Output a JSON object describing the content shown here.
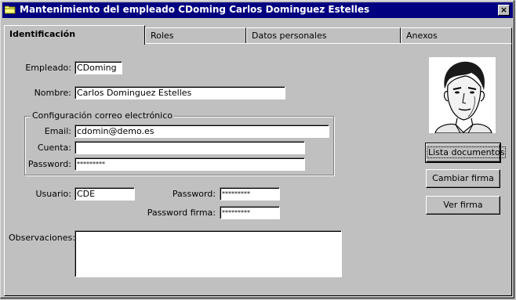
{
  "window": {
    "title": "Mantenimiento del empleado CDoming Carlos Dominguez Estelles",
    "close_label": "×"
  },
  "tabs": [
    {
      "label": "Identificación"
    },
    {
      "label": "Roles"
    },
    {
      "label": "Datos personales"
    },
    {
      "label": "Anexos"
    }
  ],
  "form": {
    "empleado_label": "Empleado:",
    "empleado_value": "CDoming",
    "nombre_label": "Nombre:",
    "nombre_value": "Carlos Dominguez Estelles",
    "email_group_title": "Configuración correo electrónico",
    "email_label": "Email:",
    "email_value": "cdomin@demo.es",
    "cuenta_label": "Cuenta:",
    "cuenta_value": "",
    "email_password_label": "Password:",
    "email_password_value": "*********",
    "usuario_label": "Usuario:",
    "usuario_value": "CDE",
    "password_label": "Password:",
    "password_value": "*********",
    "password_firma_label": "Password firma:",
    "password_firma_value": "*********",
    "observaciones_label": "Observaciones:",
    "observaciones_value": ""
  },
  "buttons": {
    "lista_documentos": "Lista documentos",
    "cambiar_firma": "Cambiar firma",
    "ver_firma": "Ver firma"
  },
  "icons": {
    "window_icon": "folder-icon",
    "photo": "employee-photo"
  }
}
